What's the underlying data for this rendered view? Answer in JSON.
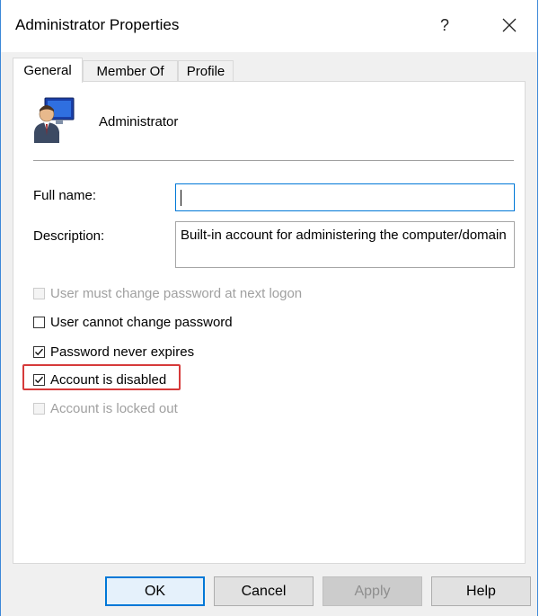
{
  "window": {
    "title": "Administrator Properties",
    "help_glyph": "?",
    "close_icon": "close-icon"
  },
  "tabs": [
    {
      "label": "General",
      "active": true
    },
    {
      "label": "Member Of",
      "active": false
    },
    {
      "label": "Profile",
      "active": false
    }
  ],
  "general": {
    "user_icon": "user-computer-icon",
    "user_name": "Administrator",
    "full_name_label": "Full name:",
    "full_name_value": "",
    "description_label": "Description:",
    "description_value": "Built-in account for administering the computer/domain"
  },
  "checkboxes": [
    {
      "label": "User must change password at next logon",
      "checked": false,
      "enabled": false
    },
    {
      "label": "User cannot change password",
      "checked": false,
      "enabled": true
    },
    {
      "label": "Password never expires",
      "checked": true,
      "enabled": true
    },
    {
      "label": "Account is disabled",
      "checked": true,
      "enabled": true,
      "highlighted": true
    },
    {
      "label": "Account is locked out",
      "checked": false,
      "enabled": false
    }
  ],
  "buttons": {
    "ok": "OK",
    "cancel": "Cancel",
    "apply": "Apply",
    "help": "Help"
  },
  "colors": {
    "accent": "#0078d7",
    "highlight_box": "#d63a3a",
    "window_border": "#3c88d8"
  }
}
